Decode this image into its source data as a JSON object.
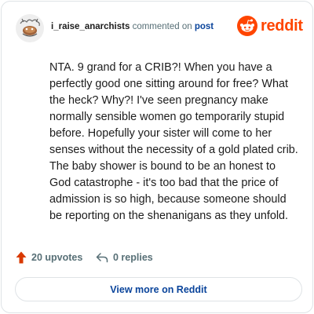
{
  "header": {
    "username": "i_raise_anarchists",
    "action_text": "commented on",
    "post_link": "post",
    "brand_name": "reddit",
    "brand_color": "#ff4500"
  },
  "comment": {
    "text": "NTA. 9 grand for a CRIB?! When you have a perfectly good one sitting around for free? What the heck? Why?! I've seen pregnancy make normally sensible women go temporarily stupid before. Hopefully your sister will come to her senses without the necessity of a gold plated crib. The baby shower is bound to be an honest to God catastrophe - it's too bad that the price of admission is so high, because someone should be reporting on the shenanigans as they unfold."
  },
  "footer": {
    "upvotes_label": "20 upvotes",
    "replies_label": "0 replies",
    "view_more_label": "View more on Reddit"
  },
  "icons": {
    "upvote": "upvote-arrow-icon",
    "reply": "reply-arrow-icon",
    "brand": "reddit-snoo-icon",
    "avatar": "user-avatar"
  },
  "colors": {
    "link": "#0a449b",
    "muted": "#576f76",
    "upvote": "#d93900",
    "border": "#dfe3e6"
  }
}
